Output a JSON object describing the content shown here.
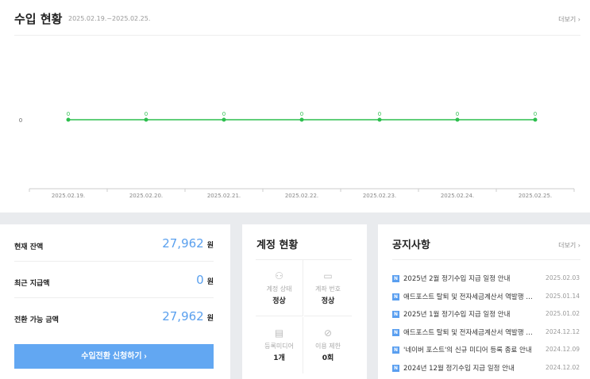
{
  "income": {
    "title": "수입 현황",
    "period": "2025.02.19.~2025.02.25.",
    "more": "더보기 ›"
  },
  "chart_data": {
    "type": "line",
    "categories": [
      "2025.02.19.",
      "2025.02.20.",
      "2025.02.21.",
      "2025.02.22.",
      "2025.02.23.",
      "2025.02.24.",
      "2025.02.25."
    ],
    "values": [
      0,
      0,
      0,
      0,
      0,
      0,
      0
    ],
    "yticks": [
      "0"
    ],
    "color": "#2dbf4e",
    "grid": false
  },
  "balance": {
    "rows": [
      {
        "label": "현재 잔액",
        "value": "27,962",
        "unit": "원"
      },
      {
        "label": "최근 지급액",
        "value": "0",
        "unit": "원"
      },
      {
        "label": "전환 가능 금액",
        "value": "27,962",
        "unit": "원"
      }
    ],
    "button": "수입전환 신청하기  ›"
  },
  "account": {
    "title": "계정 현황",
    "cells": [
      {
        "icon": "person-icon",
        "glyph": "⚇",
        "label": "계정 상태",
        "value": "정상"
      },
      {
        "icon": "card-icon",
        "glyph": "▭",
        "label": "계좌 번호",
        "value": "정상"
      },
      {
        "icon": "document-icon",
        "glyph": "▤",
        "label": "등록미디어",
        "value": "1개"
      },
      {
        "icon": "forbidden-icon",
        "glyph": "⊘",
        "label": "이용 제한",
        "value": "0회"
      }
    ]
  },
  "notices": {
    "title": "공지사항",
    "more": "더보기 ›",
    "badge": "N",
    "items": [
      {
        "title": "2025년 2월 정기수입 지급 일정 안내",
        "date": "2025.02.03"
      },
      {
        "title": "애드포스트 탈퇴 및 전자세금계산서 역발행 중단 안내",
        "date": "2025.01.14"
      },
      {
        "title": "2025년 1월 정기수입 지급 일정 안내",
        "date": "2025.01.02"
      },
      {
        "title": "애드포스트 탈퇴 및 전자세금계산서 역발행 중단 안내",
        "date": "2024.12.12"
      },
      {
        "title": "'네이버 포스트'의 신규 미디어 등록 종료 안내",
        "date": "2024.12.09"
      },
      {
        "title": "2024년 12월 정기수입 지급 일정 안내",
        "date": "2024.12.02"
      }
    ]
  }
}
